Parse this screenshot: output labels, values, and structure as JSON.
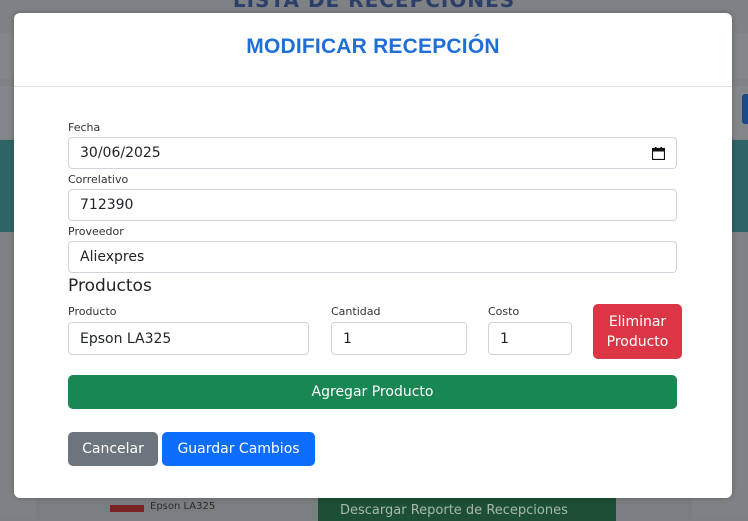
{
  "background": {
    "page_title": "LISTA DE RECEPCIONES",
    "row_product": "Epson LA325",
    "download_button": "Descargar Reporte de Recepciones"
  },
  "modal": {
    "title": "MODIFICAR RECEPCIÓN",
    "fecha": {
      "label": "Fecha",
      "value": "30/06/2025"
    },
    "correlativo": {
      "label": "Correlativo",
      "value": "712390"
    },
    "proveedor": {
      "label": "Proveedor",
      "value": "Aliexpres"
    },
    "productos_heading": "Productos",
    "product_row": {
      "producto_label": "Producto",
      "producto_value": "Epson LA325",
      "cantidad_label": "Cantidad",
      "cantidad_value": "1",
      "costo_label": "Costo",
      "costo_value": "1",
      "delete_label_line1": "Eliminar",
      "delete_label_line2": "Producto"
    },
    "add_product_label": "Agregar Producto",
    "cancel_label": "Cancelar",
    "save_label": "Guardar Cambios"
  },
  "colors": {
    "title_blue": "#1f6fd6",
    "danger": "#dc3545",
    "success": "#198754",
    "secondary": "#6c757d",
    "primary": "#0d6efd"
  },
  "icons": {
    "date_picker": "calendar-icon"
  }
}
